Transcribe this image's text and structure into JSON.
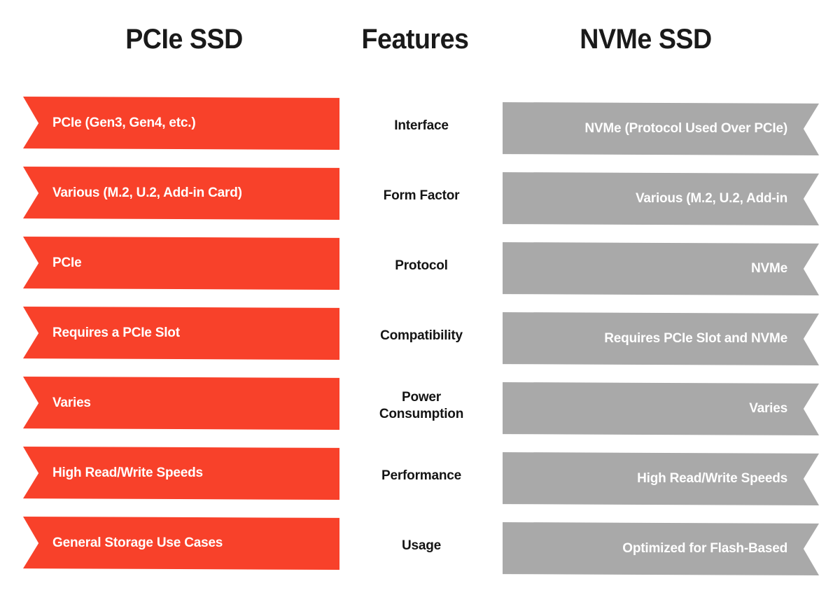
{
  "colors": {
    "accent": "#f8412a",
    "muted": "#a9a9a9",
    "heading": "#1a1a1a",
    "band_text": "#ffffff",
    "center_text": "#141414",
    "background": "#ffffff"
  },
  "headers": {
    "left": "PCIe SSD",
    "center": "Features",
    "right": "NVMe SSD"
  },
  "rows": [
    {
      "feature": "Interface",
      "pcie": "PCIe (Gen3, Gen4, etc.)",
      "nvme": "NVMe (Protocol Used Over PCIe)"
    },
    {
      "feature": "Form Factor",
      "pcie": "Various (M.2, U.2, Add-in Card)",
      "nvme": "Various (M.2, U.2, Add-in"
    },
    {
      "feature": "Protocol",
      "pcie": "PCIe",
      "nvme": "NVMe"
    },
    {
      "feature": "Compatibility",
      "pcie": "Requires a PCIe Slot",
      "nvme": "Requires PCIe Slot and NVMe"
    },
    {
      "feature": "Power\nConsumption",
      "pcie": "Varies",
      "nvme": "Varies"
    },
    {
      "feature": "Performance",
      "pcie": "High Read/Write Speeds",
      "nvme": "High Read/Write Speeds"
    },
    {
      "feature": "Usage",
      "pcie": "General Storage Use Cases",
      "nvme": "Optimized for Flash-Based"
    }
  ]
}
